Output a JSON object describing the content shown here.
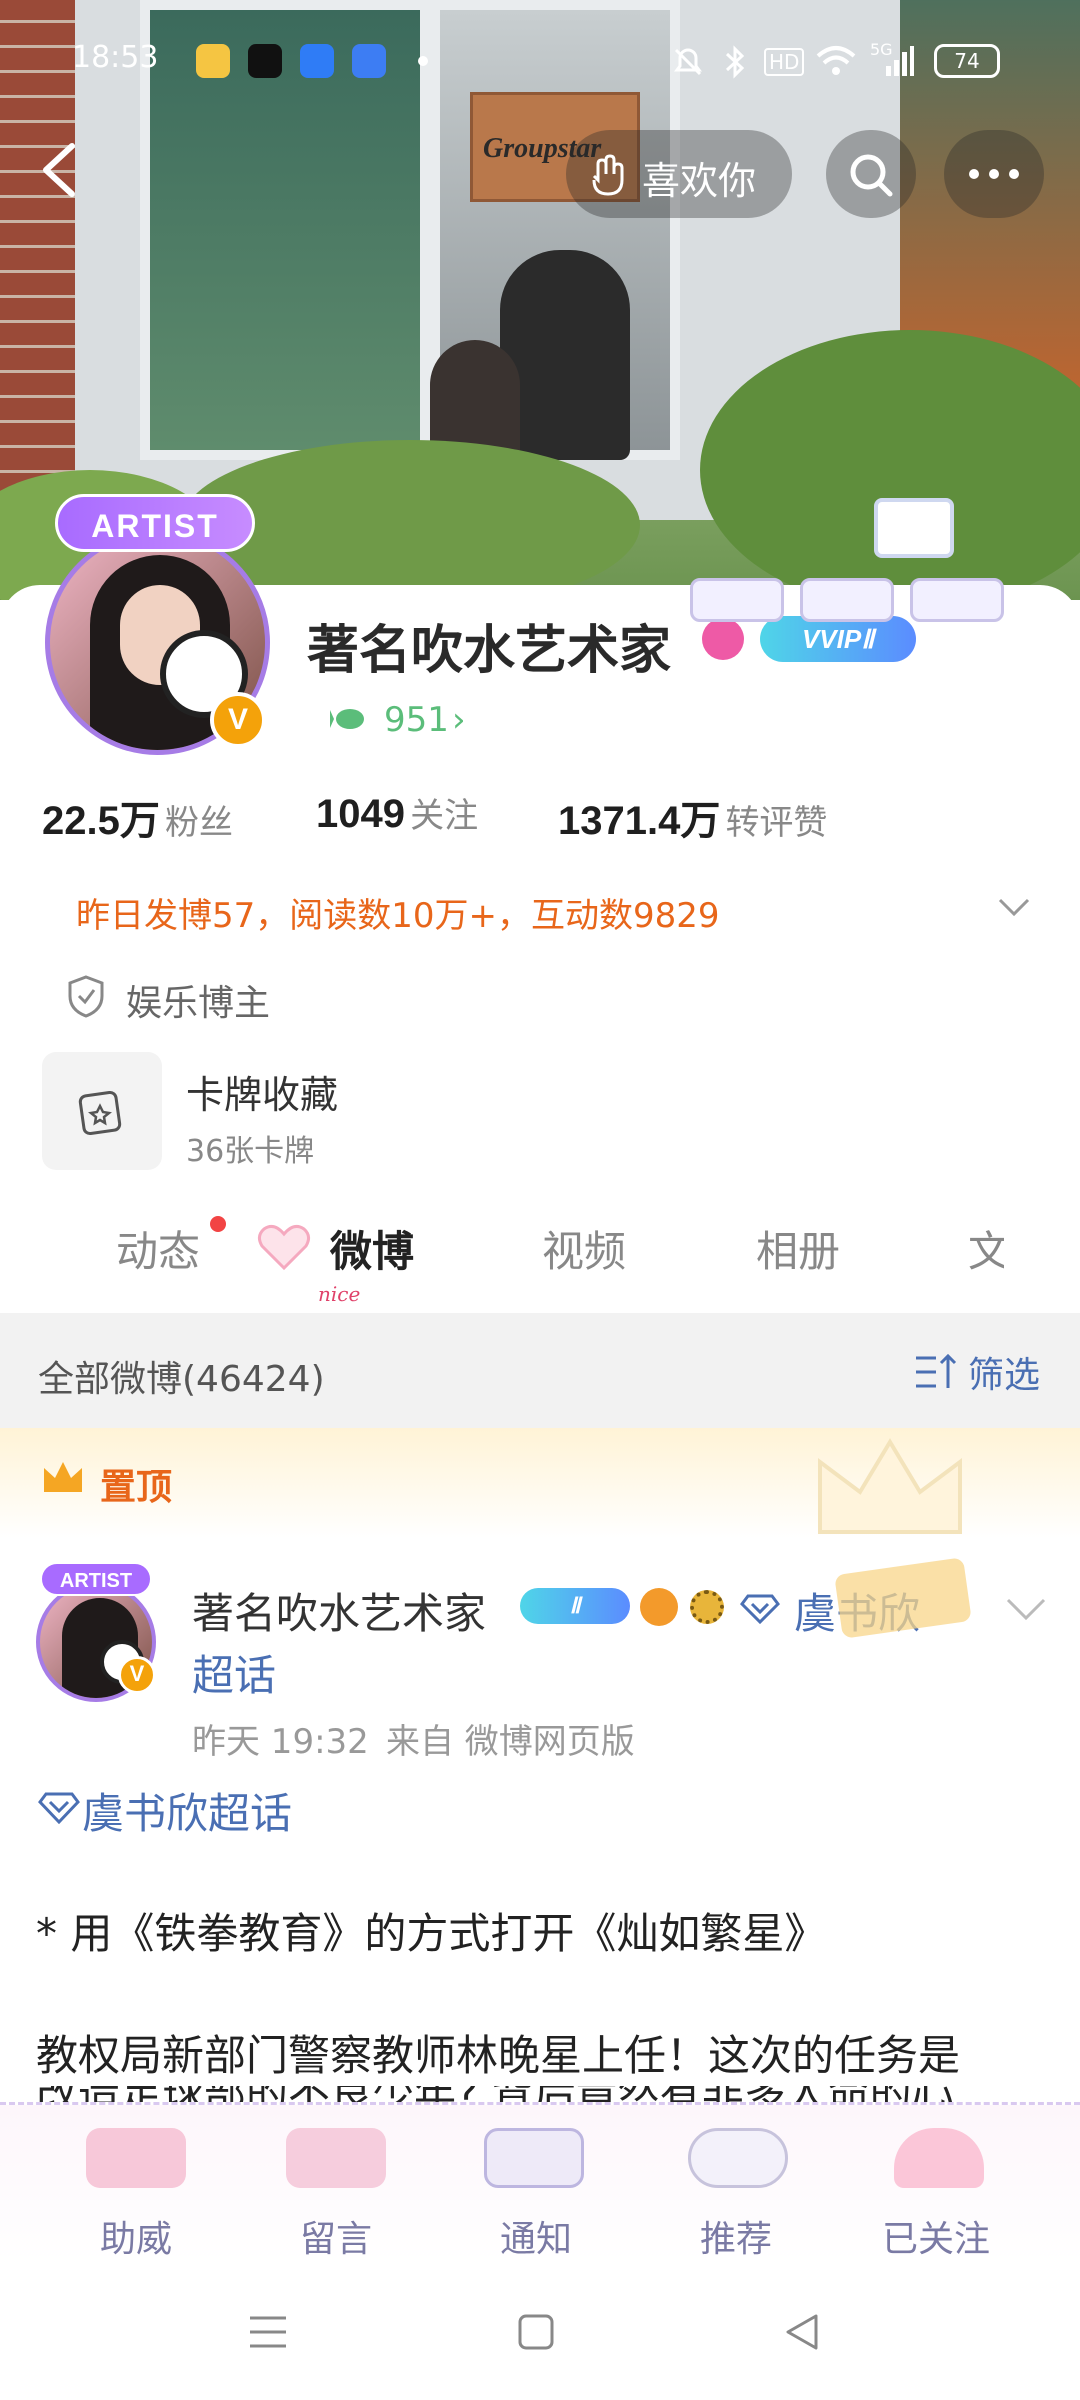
{
  "status_bar": {
    "time": "18:53",
    "network": "5G",
    "battery": "74",
    "hd": "HD"
  },
  "top_nav": {
    "like_label": "喜欢你"
  },
  "hero": {
    "box_text": "Groupstar"
  },
  "profile": {
    "artist_tag": "ARTIST",
    "name": "著名吹水艺术家",
    "vvip": "VVIPⅡ",
    "fan_level": "951",
    "fan_arrow": "›",
    "stats": [
      {
        "num": "22.5万",
        "label": "粉丝"
      },
      {
        "num": "1049",
        "label": "关注"
      },
      {
        "num": "1371.4万",
        "label": "转评赞"
      }
    ],
    "daily_summary": "昨日发博57，阅读数10万+，互动数9829",
    "category": "娱乐博主",
    "cards": {
      "title": "卡牌收藏",
      "count": "36张卡牌"
    }
  },
  "tabs": [
    {
      "label": "动态"
    },
    {
      "label": "微博",
      "sub": "nice"
    },
    {
      "label": "视频"
    },
    {
      "label": "相册"
    },
    {
      "label": "文"
    }
  ],
  "feed_header": {
    "all_posts": "全部微博(46424)",
    "filter": "筛选"
  },
  "pinned": {
    "label": "置顶"
  },
  "post": {
    "artist_tag": "ARTIST",
    "author": "著名吹水艺术家",
    "badge_level": "Ⅱ",
    "topic_inline": "虞书欣",
    "topic_wrap": "超话",
    "time": "昨天 19:32",
    "source": "来自 微博网页版",
    "topic_link": "虞书欣超话",
    "line1": "* 用《铁拳教育》的方式打开《灿如繁星》",
    "line2": "教权局新部门警察教师林晚星上任！这次的任务是",
    "line3": "改造足球部的不良少年?  背后竟然有非多人命的心"
  },
  "bottom_actions": [
    "助威",
    "留言",
    "通知",
    "推荐",
    "已关注"
  ],
  "colors": {
    "accent_orange": "#e8661a",
    "link_blue": "#4a6fb3",
    "vip_blue": "#5b8cff",
    "artist_purple": "#a86bff"
  }
}
